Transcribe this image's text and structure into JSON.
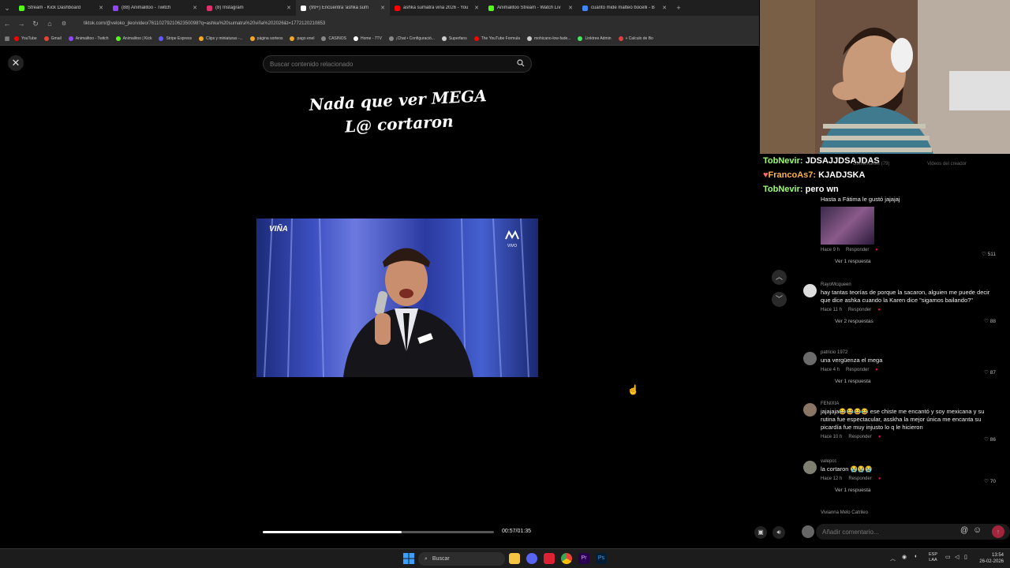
{
  "browser": {
    "tabs": [
      {
        "title": "Stream - Kick Dashboard",
        "color": "#53fc18",
        "active": false
      },
      {
        "title": "(88) Animalitoo - Twitch",
        "color": "#9146ff",
        "active": false
      },
      {
        "title": "(8) Instagram",
        "color": "#e1306c",
        "active": false
      },
      {
        "title": "(99+) Encuentra 'ashka sum",
        "color": "#ffffff",
        "active": true
      },
      {
        "title": "ashka sumatra viña 2026 - You",
        "color": "#ff0000",
        "active": false
      },
      {
        "title": "Animalitoo Stream - Watch Liv",
        "color": "#53fc18",
        "active": false
      },
      {
        "title": "cuanto mide matteo bocelli - B",
        "color": "#4285f4",
        "active": false
      }
    ],
    "url": "tiktok.com/@veloko_jleo/video/7611027921062350098?q=ashka%20sumatra%20viña%202026&t=1772120210853",
    "bookmarks": [
      {
        "label": "YouTube",
        "color": "#ff0000"
      },
      {
        "label": "Gmail",
        "color": "#ea4335"
      },
      {
        "label": "Animalitoo - Twitch",
        "color": "#9146ff"
      },
      {
        "label": "Animalitoo | Kick",
        "color": "#53fc18"
      },
      {
        "label": "Stripe Express",
        "color": "#635bff"
      },
      {
        "label": "Clips y miniaturas -...",
        "color": "#f5a623"
      },
      {
        "label": "página sorteos",
        "color": "#f5a623"
      },
      {
        "label": "pago enel",
        "color": "#f5a623"
      },
      {
        "label": "CASINOS",
        "color": "#888888"
      },
      {
        "label": "Home - 7TV",
        "color": "#ffffff"
      },
      {
        "label": "¡Chat • Configuració...",
        "color": "#888888"
      },
      {
        "label": "Superfans",
        "color": "#cccccc"
      },
      {
        "label": "The YouTube Formula",
        "color": "#ff0000"
      },
      {
        "label": "mohicano-low-fade...",
        "color": "#cccccc"
      },
      {
        "label": "Linktree Admin",
        "color": "#43e660"
      },
      {
        "label": "» Calculo de Bo",
        "color": "#e04040"
      }
    ]
  },
  "viewer": {
    "search_placeholder": "Buscar contenido relacionado",
    "overlay_line1": "Nada que ver MEGA",
    "overlay_line2": "L@ cortaron",
    "watermark": "VIÑA",
    "channel_logo": "VIVO",
    "time": "00:57/01:35",
    "progress": 0.6
  },
  "chat": [
    {
      "user": "TobNevir:",
      "text": "JDSAJJDSAJDAS"
    },
    {
      "user": "FrancoAs7:",
      "text": "KJADJSKA"
    },
    {
      "user": "TobNevir:",
      "text": "pero wn"
    }
  ],
  "comments_header": {
    "tab1": "Comentarios (79)",
    "tab2": "Videos del creador"
  },
  "comments": [
    {
      "user": "",
      "text": "Hasta a Fátima le gustó jajajaj",
      "time": "Hace 9 h",
      "reply": "Responder",
      "likes": "511",
      "replies": "Ver 1 respuesta"
    },
    {
      "user": "RayoMcqueen",
      "text": "hay tantas teorías de porque la sacaron, alguien me puede decir que dice ashka cuando la Karen dice \"sigamos bailando?\"",
      "time": "Hace 11 h",
      "reply": "Responder",
      "likes": "88",
      "replies": "Ver 2 respuestas"
    },
    {
      "user": "patricio 1972",
      "text": "una vergüenza el mega",
      "time": "Hace 4 h",
      "reply": "Responder",
      "likes": "87",
      "replies": "Ver 1 respuesta"
    },
    {
      "user": "FENIXIA",
      "text": "jajajaja😂😂😂😂 ese chiste me encantó y soy mexicana y su rutina fue espectacular, asskha la mejor única me encanta su picardía fue muy injusto lo q le hicieron",
      "time": "Hace 10 h",
      "reply": "Responder",
      "likes": "86",
      "replies": ""
    },
    {
      "user": "valepcc",
      "text": "la cortaron 😭😭😭",
      "time": "Hace 12 h",
      "reply": "Responder",
      "likes": "70",
      "replies": "Ver 1 respuesta"
    },
    {
      "user": "Vivianna Melo Catrileo",
      "text": "",
      "time": "",
      "reply": "",
      "likes": "",
      "replies": ""
    }
  ],
  "comment_input_placeholder": "Añadir comentario...",
  "taskbar": {
    "search": "Buscar",
    "lang1": "ESP",
    "lang2": "LAA",
    "time": "13:54",
    "date": "26-02-2026"
  }
}
